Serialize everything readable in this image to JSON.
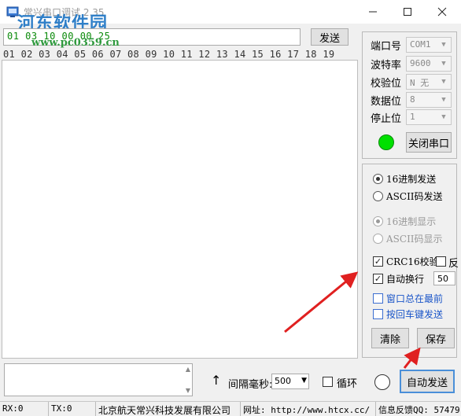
{
  "window": {
    "title": "常兴串口调试 2.35",
    "watermark": "河东软件园",
    "watermark_url": "www.pc0359.cn",
    "minimize_icon": "minimize-icon",
    "maximize_icon": "maximize-icon",
    "close_icon": "close-icon"
  },
  "send": {
    "input_value": "01 03 10 00 00 25",
    "send_label": "发送"
  },
  "ruler": "01 02 03 04 05 06 07 08 09 10 11 12 13 14 15 16 17 18 19",
  "port_settings": {
    "port_label": "端口号",
    "port_value": "COM1",
    "baud_label": "波特率",
    "baud_value": "9600",
    "parity_label": "校验位",
    "parity_value": "N 无",
    "databits_label": "数据位",
    "databits_value": "8",
    "stopbits_label": "停止位",
    "stopbits_value": "1",
    "close_port_label": "关闭串口",
    "led_color": "#00e000"
  },
  "options": {
    "hex_send_label": "16进制发送",
    "ascii_send_label": "ASCII码发送",
    "hex_display_label": "16进制显示",
    "ascii_display_label": "ASCII码显示",
    "crc_label": "CRC16校验",
    "reverse_label": "反",
    "auto_newline_label": "自动换行",
    "auto_newline_value": "50",
    "always_on_top_label": "窗口总在最前",
    "enter_send_label": "按回车键发送",
    "clear_label": "清除",
    "save_label": "保存"
  },
  "bottom": {
    "arrow_glyph": "↑",
    "interval_label": "间隔毫秒:",
    "interval_value": "500",
    "loop_label": "循环",
    "auto_send_label": "自动发送"
  },
  "status": {
    "rx": "RX:0",
    "tx": "TX:0",
    "company": "北京航天常兴科技发展有限公司",
    "website": "网址: http://www.htcx.cc/",
    "feedback": "信息反馈QQ: 57479"
  },
  "colors": {
    "annotation_arrow": "#e02020",
    "accent_blue": "#1a55c8",
    "hex_green": "#0a8a0a"
  }
}
